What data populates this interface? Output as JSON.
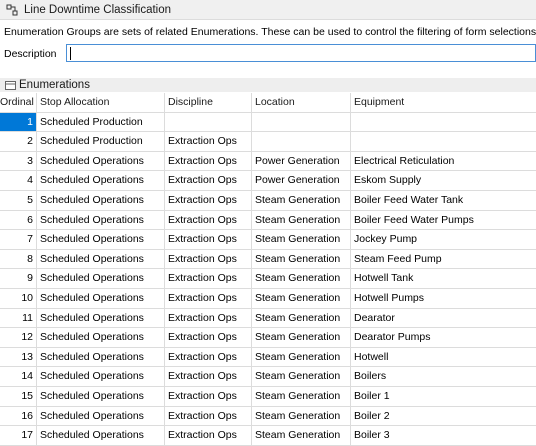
{
  "header": {
    "title": "Line Downtime Classification",
    "icon": "node-link-icon"
  },
  "description_text": "Enumeration Groups are sets of related Enumerations. These can be used to control the filtering of form selections.",
  "description_field": {
    "label": "Description",
    "value": ""
  },
  "enumerations": {
    "title": "Enumerations",
    "icon": "collapse-panel-icon",
    "columns": [
      "Ordinal",
      "Stop Allocation",
      "Discipline",
      "Location",
      "Equipment"
    ],
    "selected_row": 0,
    "rows": [
      [
        "1",
        "Scheduled Production",
        "",
        "",
        ""
      ],
      [
        "2",
        "Scheduled Production",
        "Extraction Ops",
        "",
        ""
      ],
      [
        "3",
        "Scheduled Operations",
        "Extraction Ops",
        "Power Generation",
        "Electrical Reticulation"
      ],
      [
        "4",
        "Scheduled Operations",
        "Extraction Ops",
        "Power Generation",
        "Eskom Supply"
      ],
      [
        "5",
        "Scheduled Operations",
        "Extraction Ops",
        "Steam Generation",
        "Boiler Feed Water Tank"
      ],
      [
        "6",
        "Scheduled Operations",
        "Extraction Ops",
        "Steam Generation",
        "Boiler Feed Water Pumps"
      ],
      [
        "7",
        "Scheduled Operations",
        "Extraction Ops",
        "Steam Generation",
        "Jockey Pump"
      ],
      [
        "8",
        "Scheduled Operations",
        "Extraction Ops",
        "Steam Generation",
        "Steam Feed Pump"
      ],
      [
        "9",
        "Scheduled Operations",
        "Extraction Ops",
        "Steam Generation",
        "Hotwell Tank"
      ],
      [
        "10",
        "Scheduled Operations",
        "Extraction Ops",
        "Steam Generation",
        "Hotwell Pumps"
      ],
      [
        "11",
        "Scheduled Operations",
        "Extraction Ops",
        "Steam Generation",
        "Dearator"
      ],
      [
        "12",
        "Scheduled Operations",
        "Extraction Ops",
        "Steam Generation",
        "Dearator Pumps"
      ],
      [
        "13",
        "Scheduled Operations",
        "Extraction Ops",
        "Steam Generation",
        "Hotwell"
      ],
      [
        "14",
        "Scheduled Operations",
        "Extraction Ops",
        "Steam Generation",
        "Boilers"
      ],
      [
        "15",
        "Scheduled Operations",
        "Extraction Ops",
        "Steam Generation",
        "Boiler 1"
      ],
      [
        "16",
        "Scheduled Operations",
        "Extraction Ops",
        "Steam Generation",
        "Boiler 2"
      ],
      [
        "17",
        "Scheduled Operations",
        "Extraction Ops",
        "Steam Generation",
        "Boiler 3"
      ]
    ]
  },
  "colors": {
    "selection": "#0078d7",
    "input_border": "#4a8fd6",
    "grid_line": "#dcdcdc",
    "header_bg": "#f0f0f0"
  }
}
